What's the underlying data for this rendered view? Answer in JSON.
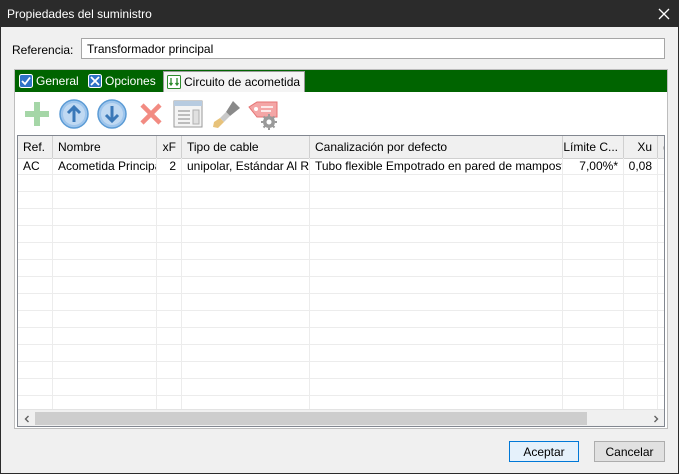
{
  "window": {
    "title": "Propiedades del suministro"
  },
  "reference": {
    "label": "Referencia:",
    "value": "Transformador principal"
  },
  "tabs": [
    {
      "label": "General",
      "icon": "checkbox-icon"
    },
    {
      "label": "Opciones",
      "icon": "tools-icon"
    },
    {
      "label": "Circuito de acometida",
      "icon": "circuit-icon"
    }
  ],
  "toolbar": [
    {
      "name": "add-button",
      "icon": "plus-icon"
    },
    {
      "name": "move-up-button",
      "icon": "arrow-up-icon"
    },
    {
      "name": "move-down-button",
      "icon": "arrow-down-icon"
    },
    {
      "name": "delete-button",
      "icon": "x-icon"
    },
    {
      "name": "edit-button",
      "icon": "form-window-icon"
    },
    {
      "name": "clean-button",
      "icon": "brush-icon"
    },
    {
      "name": "tag-settings-button",
      "icon": "tag-gear-icon"
    }
  ],
  "table": {
    "columns": [
      "Ref.",
      "Nombre",
      "xF",
      "Tipo de cable",
      "Canalización por defecto",
      "Límite C...",
      "Xu",
      "("
    ],
    "rows": [
      [
        "AC",
        "Acometida Principal",
        "2",
        "unipolar, Estándar Al RZ",
        "Tubo flexible Empotrado en pared de mampostería",
        "7,00%*",
        "0,08",
        "."
      ]
    ]
  },
  "buttons": {
    "accept": "Aceptar",
    "cancel": "Cancelar"
  },
  "colors": {
    "tabbar": "#006400",
    "titlebar": "#2b2b2b",
    "accent": "#0078d7"
  }
}
